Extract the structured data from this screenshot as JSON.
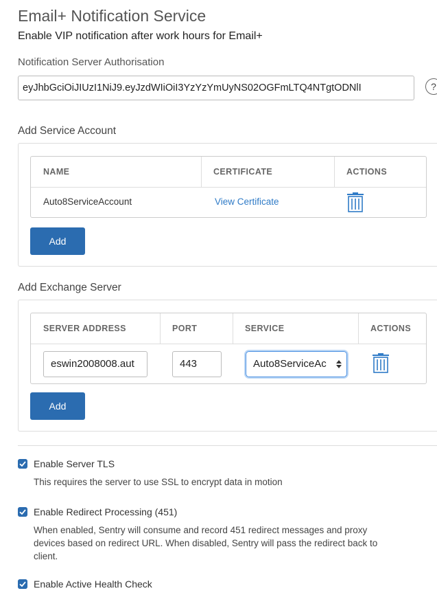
{
  "header": {
    "title": "Email+ Notification Service",
    "subtitle": "Enable VIP notification after work hours for Email+"
  },
  "auth": {
    "label": "Notification Server Authorisation",
    "token": "eyJhbGciOiJIUzI1NiJ9.eyJzdWIiOiI3YzYzYmUyNS02OGFmLTQ4NTgtODNlI",
    "help_icon": "?"
  },
  "service_account": {
    "section_title": "Add Service Account",
    "columns": [
      "NAME",
      "CERTIFICATE",
      "ACTIONS"
    ],
    "rows": [
      {
        "name": "Auto8ServiceAccount",
        "certificate": "View Certificate"
      }
    ],
    "add_label": "Add"
  },
  "exchange": {
    "section_title": "Add Exchange Server",
    "columns": [
      "SERVER ADDRESS",
      "PORT",
      "SERVICE",
      "ACTIONS"
    ],
    "rows": [
      {
        "server_address": "eswin2008008.aut",
        "port": "443",
        "service": "Auto8ServiceAc"
      }
    ],
    "add_label": "Add"
  },
  "options": [
    {
      "label": "Enable Server TLS",
      "checked": true,
      "description": "This requires the server to use SSL to encrypt data in motion"
    },
    {
      "label": "Enable Redirect Processing (451)",
      "checked": true,
      "description_lines": [
        "When enabled, Sentry will consume and record 451 redirect messages and proxy",
        "devices based on redirect URL. When disabled, Sentry will pass the redirect back to",
        "client."
      ]
    },
    {
      "label": "Enable Active Health Check",
      "checked": true
    }
  ],
  "colors": {
    "accent": "#2b6cb0",
    "link": "#2f7bc7"
  }
}
